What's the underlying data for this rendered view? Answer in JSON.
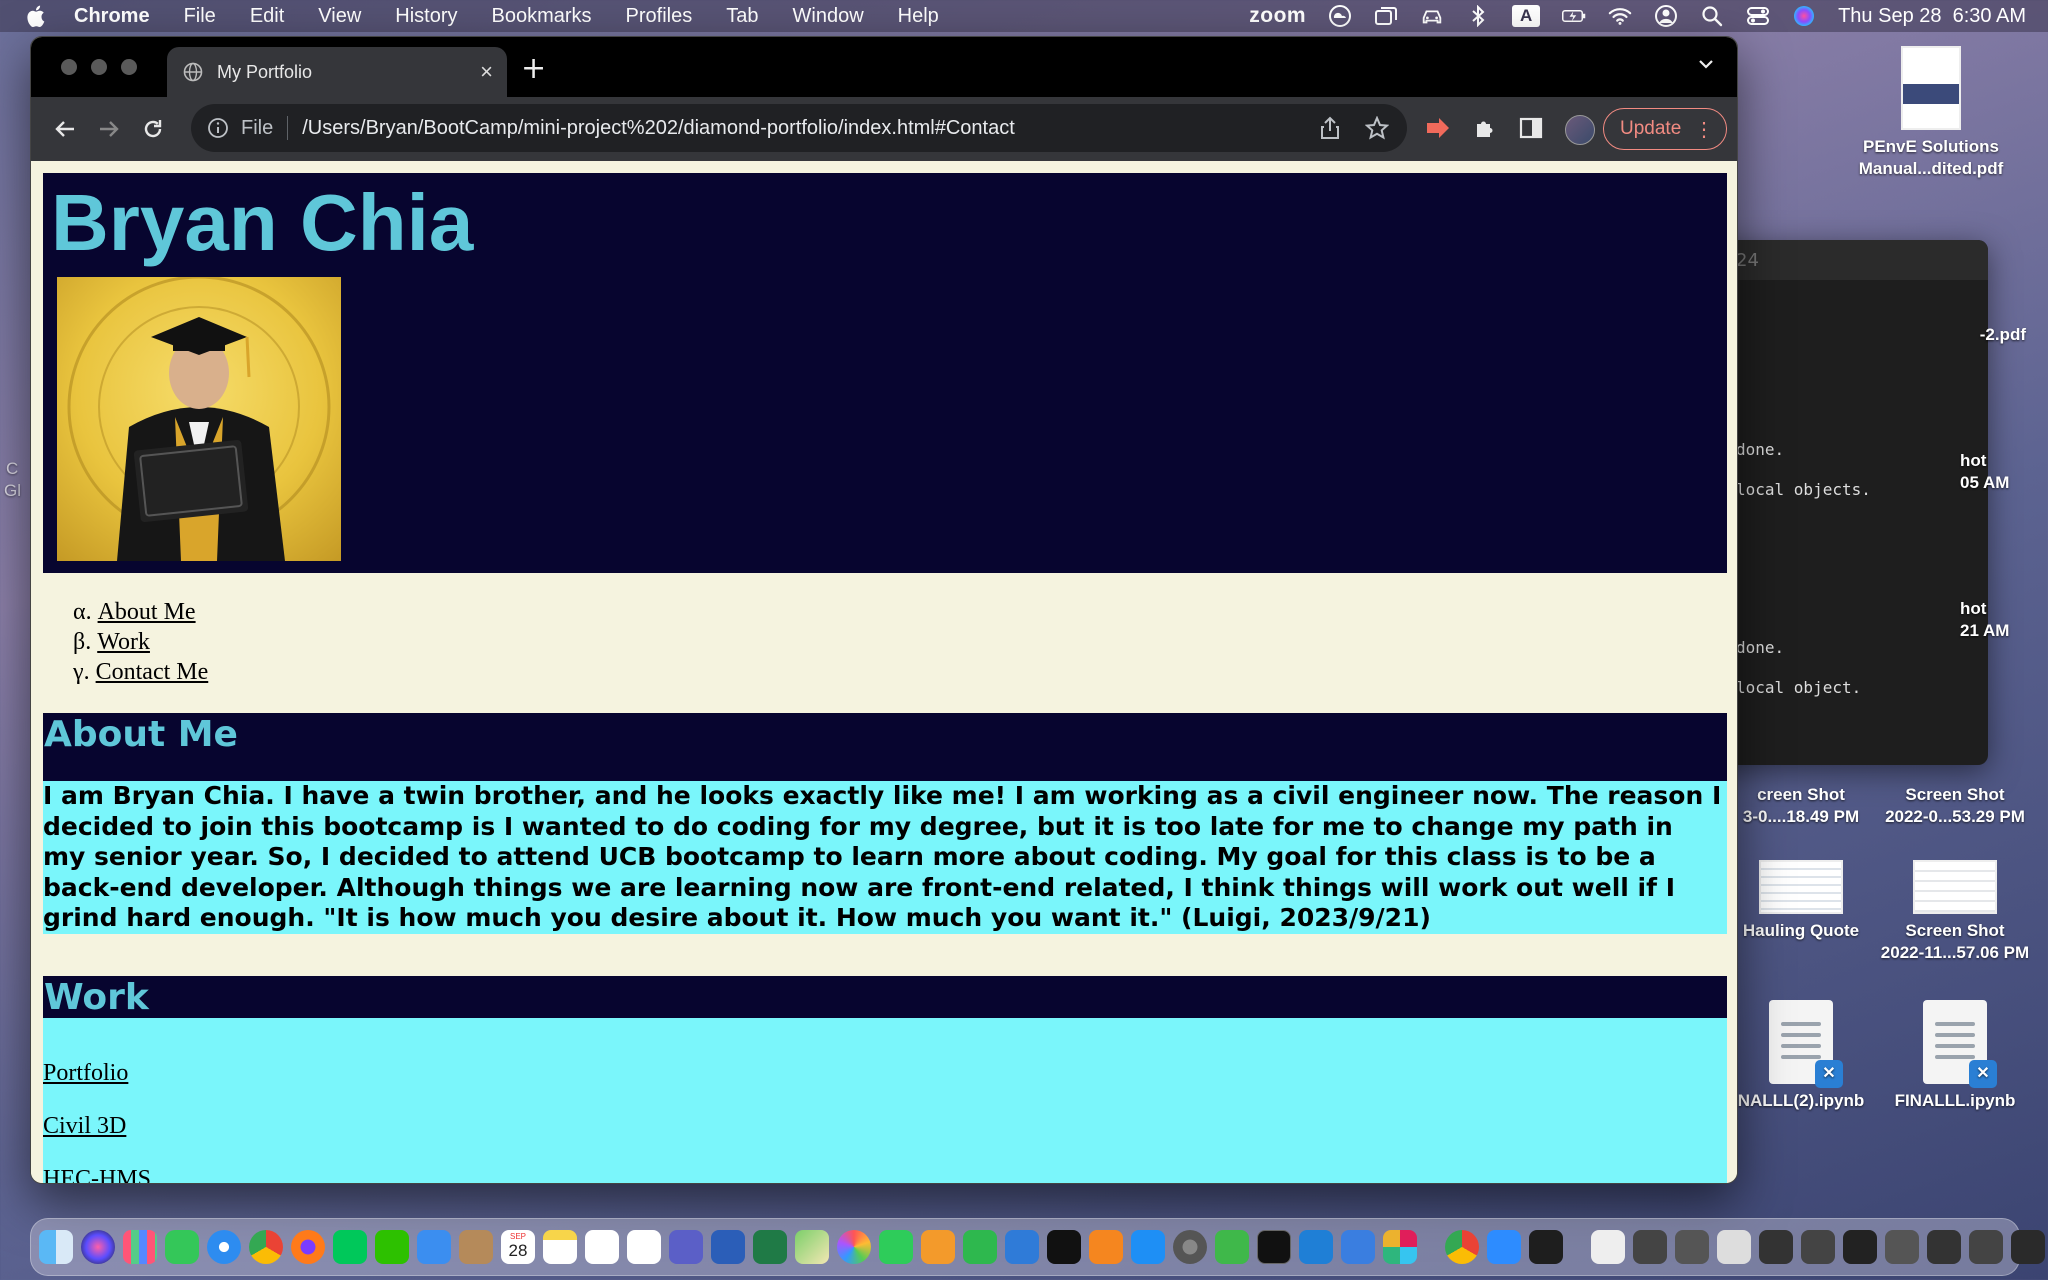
{
  "menubar": {
    "app_name": "Chrome",
    "items": [
      "File",
      "Edit",
      "View",
      "History",
      "Bookmarks",
      "Profiles",
      "Tab",
      "Window",
      "Help"
    ],
    "zoom": "zoom",
    "input_source": "A",
    "datetime": "Thu Sep 28  6:30 AM"
  },
  "browser": {
    "tab_title": "My Portfolio",
    "scheme": "File",
    "url": "/Users/Bryan/BootCamp/mini-project%202/diamond-portfolio/index.html#Contact",
    "update_label": "Update"
  },
  "page": {
    "name": "Bryan Chia",
    "nav": [
      {
        "marker": "α.",
        "label": "About Me"
      },
      {
        "marker": "β.",
        "label": "Work"
      },
      {
        "marker": "γ.",
        "label": "Contact Me"
      }
    ],
    "about_heading": "About Me",
    "about_text": "I am Bryan Chia. I have a twin brother, and he looks exactly like me! I am working as a civil engineer now. The reason I decided to join this bootcamp is I wanted to do coding for my degree, but it is too late for me to change my path in my senior year. So, I decided to attend UCB bootcamp to learn more about coding. My goal for this class is to be a back-end developer. Although things we are learning now are front-end related, I think things will work out well if I grind hard enough. \"It is how much you desire about it. How much you want it.\" (Luigi, 2023/9/21)",
    "work_heading": "Work",
    "work_links": [
      "Portfolio",
      "Civil 3D",
      "HEC-HMS"
    ]
  },
  "desktop": {
    "files": [
      {
        "label_1": "PEnvE Solutions",
        "label_2": "Manual...dited.pdf"
      },
      {
        "label_1": "Screen Shot",
        "label_2": "2022-0...53.29 PM"
      },
      {
        "label_1": "creen Shot",
        "label_2": "3-0....18.49 PM"
      },
      {
        "label_1": "Hauling Quote",
        "label_2": ""
      },
      {
        "label_1": "Screen Shot",
        "label_2": "2022-11...57.06 PM"
      },
      {
        "label_1": "NALLL(2).ipynb",
        "label_2": ""
      },
      {
        "label_1": "FINALLL.ipynb",
        "label_2": ""
      }
    ],
    "partial_labels": [
      "-2.pdf",
      "hot",
      "05 AM",
      "hot",
      "21 AM",
      "C",
      "Gl"
    ]
  },
  "terminal": {
    "title": "24",
    "lines": [
      "done.",
      "local objects.",
      "done.",
      "local object."
    ]
  },
  "colors": {
    "header_bg": "#07052f",
    "heading_text": "#5fc7d9",
    "section_body_bg": "#7af6fb",
    "page_bg": "#f5f3df",
    "update_accent": "#f28b82"
  },
  "dock": {
    "calendar_month": "SEP",
    "calendar_day": "28"
  }
}
